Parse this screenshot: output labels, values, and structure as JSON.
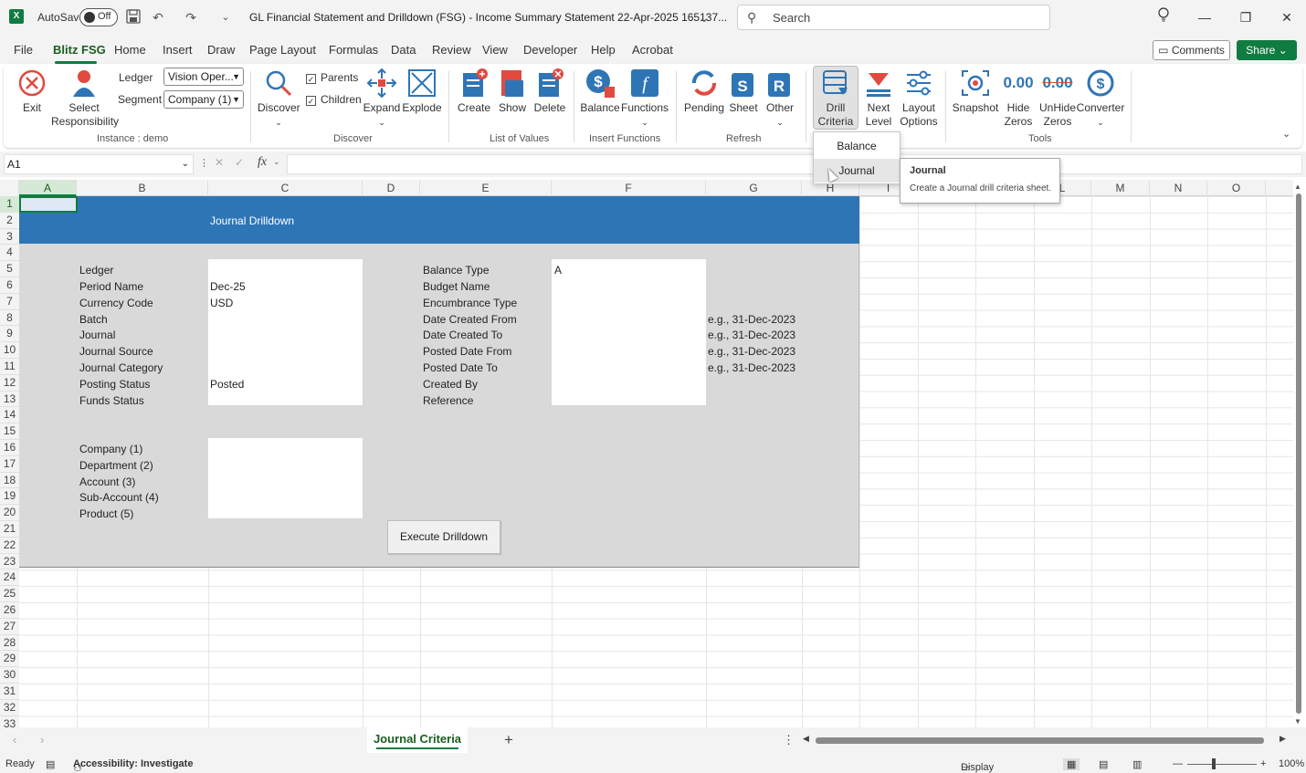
{
  "app": {
    "autosave_label": "AutoSave",
    "autosave_state": "Off",
    "doc_title": "GL Financial Statement and Drilldown (FSG) - Income Summary Statement 22-Apr-2025 165137...",
    "search_placeholder": "Search"
  },
  "menu": {
    "tabs": [
      "File",
      "Blitz FSG",
      "Home",
      "Insert",
      "Draw",
      "Page Layout",
      "Formulas",
      "Data",
      "Review",
      "View",
      "Developer",
      "Help",
      "Acrobat"
    ],
    "active": "Blitz FSG",
    "comments": "Comments",
    "share": "Share"
  },
  "ribbon": {
    "exit": "Exit",
    "select_responsibility": "Select Responsibility",
    "ledger_label": "Ledger",
    "ledger_value": "Vision Oper...",
    "segment_label": "Segment",
    "segment_value": "Company (1)",
    "group_instance": "Instance : demo",
    "discover": "Discover",
    "parents": "Parents",
    "children": "Children",
    "expand": "Expand",
    "explode": "Explode",
    "group_discover": "Discover",
    "create": "Create",
    "show": "Show",
    "delete": "Delete",
    "group_lov": "List of Values",
    "balance": "Balance",
    "functions": "Functions",
    "group_insert": "Insert Functions",
    "pending": "Pending",
    "sheet": "Sheet",
    "other": "Other",
    "group_refresh": "Refresh",
    "drill_criteria": "Drill Criteria",
    "next_level": "Next Level",
    "layout_options": "Layout Options",
    "snapshot": "Snapshot",
    "hide_zeros": "Hide Zeros",
    "unhide_zeros": "UnHide Zeros",
    "converter": "Converter",
    "group_tools": "Tools",
    "zeros_glyph": "0.00"
  },
  "dropdown": {
    "items": [
      "Balance",
      "Journal"
    ],
    "tooltip_title": "Journal",
    "tooltip_desc": "Create a Journal drill criteria sheet."
  },
  "formula_bar": {
    "cell_ref": "A1",
    "fx": "fx"
  },
  "columns": [
    "A",
    "B",
    "C",
    "D",
    "E",
    "F",
    "G",
    "H",
    "I",
    "L",
    "M",
    "N",
    "O"
  ],
  "rows": [
    "1",
    "2",
    "3",
    "4",
    "5",
    "6",
    "7",
    "8",
    "9",
    "10",
    "11",
    "12",
    "13",
    "14",
    "15",
    "16",
    "17",
    "18",
    "19",
    "20",
    "21",
    "22",
    "23",
    "24",
    "25",
    "26",
    "27",
    "28",
    "29",
    "30",
    "31",
    "32",
    "33"
  ],
  "sheet": {
    "title": "Journal Drilldown",
    "left_labels": [
      "Ledger",
      "Period Name",
      "Currency Code",
      "Batch",
      "Journal",
      "Journal Source",
      "Journal Category",
      "Posting Status",
      "Funds Status"
    ],
    "left_values": [
      "",
      "Dec-25",
      "USD",
      "",
      "",
      "",
      "",
      "Posted",
      ""
    ],
    "right_labels": [
      "Balance Type",
      "Budget Name",
      "Encumbrance Type",
      "Date Created From",
      "Date Created To",
      "Posted Date From",
      "Posted Date To",
      "Created By",
      "Reference"
    ],
    "right_values": [
      "A",
      "",
      "",
      "",
      "",
      "",
      "",
      "",
      ""
    ],
    "hints": [
      "e.g., 31-Dec-2023",
      "e.g., 31-Dec-2023",
      "e.g., 31-Dec-2023",
      "e.g., 31-Dec-2023"
    ],
    "segment_labels": [
      "Company (1)",
      "Department (2)",
      "Account (3)",
      "Sub-Account (4)",
      "Product (5)"
    ],
    "execute_button": "Execute Drilldown"
  },
  "sheet_tabs": {
    "active": "Journal Criteria"
  },
  "status": {
    "ready": "Ready",
    "accessibility": "Accessibility: Investigate",
    "display_settings": "Display Settings",
    "zoom": "100%"
  },
  "colors": {
    "excel_green": "#107c41",
    "banner_blue": "#2e75b6",
    "form_gray": "#d9d9d9"
  }
}
